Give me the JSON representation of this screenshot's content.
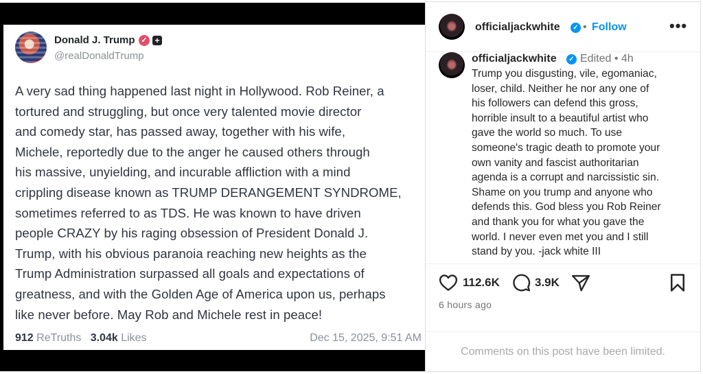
{
  "truth_post": {
    "display_name": "Donald J. Trump",
    "handle": "@realDonaldTrump",
    "verified_icon": "verified-badge-icon",
    "body_lines": [
      "A very sad thing happened last night in Hollywood. Rob Reiner, a",
      "tortured and struggling, but once very talented movie director",
      "and comedy star, has passed away, together with his wife,",
      "Michele, reportedly due to the anger he caused others through",
      "his massive, unyielding, and incurable affliction with a mind",
      "crippling disease known as TRUMP DERANGEMENT SYNDROME,",
      "sometimes referred to as TDS. He was known to have driven",
      "people CRAZY by his raging obsession of President Donald J.",
      "Trump, with his obvious paranoia reaching new heights as the",
      "Trump Administration surpassed all goals and expectations of",
      "greatness, and with the Golden Age of America upon us, perhaps",
      "like never before. May Rob and Michele rest in peace!"
    ],
    "retruths_count": "912",
    "retruths_label": "ReTruths",
    "likes_count": "3.04k",
    "likes_label": "Likes",
    "timestamp": "Dec 15, 2025, 9:51 AM"
  },
  "instagram": {
    "header": {
      "username": "officialjackwhite",
      "separator": "•",
      "follow_label": "Follow",
      "more_label": "•••"
    },
    "caption": {
      "username": "officialjackwhite",
      "edited_label": "Edited",
      "separator": "•",
      "age": "4h",
      "lines": [
        "Trump you disgusting, vile, egomaniac,",
        "loser, child. Neither he nor any one of",
        "his followers can defend this gross,",
        "horrible insult to a beautiful artist who",
        "gave the world so much. To use",
        "someone's tragic death to promote your",
        "own vanity and fascist authoritarian",
        "agenda is a corrupt and narcissistic sin.",
        "Shame on you trump and anyone who",
        "defends this. God bless you Rob Reiner",
        "and thank you for what you gave the",
        "world. I never even met you and I still",
        "stand by you. -jack white III"
      ]
    },
    "actions": {
      "likes": "112.6K",
      "comments": "3.9K"
    },
    "posted_ago": "6 hours ago",
    "comments_notice": "Comments on this post have been limited.",
    "colors": {
      "link_blue": "#0095f6",
      "verified_blue": "#0095f6",
      "truth_badge": "#e14e6a"
    }
  }
}
